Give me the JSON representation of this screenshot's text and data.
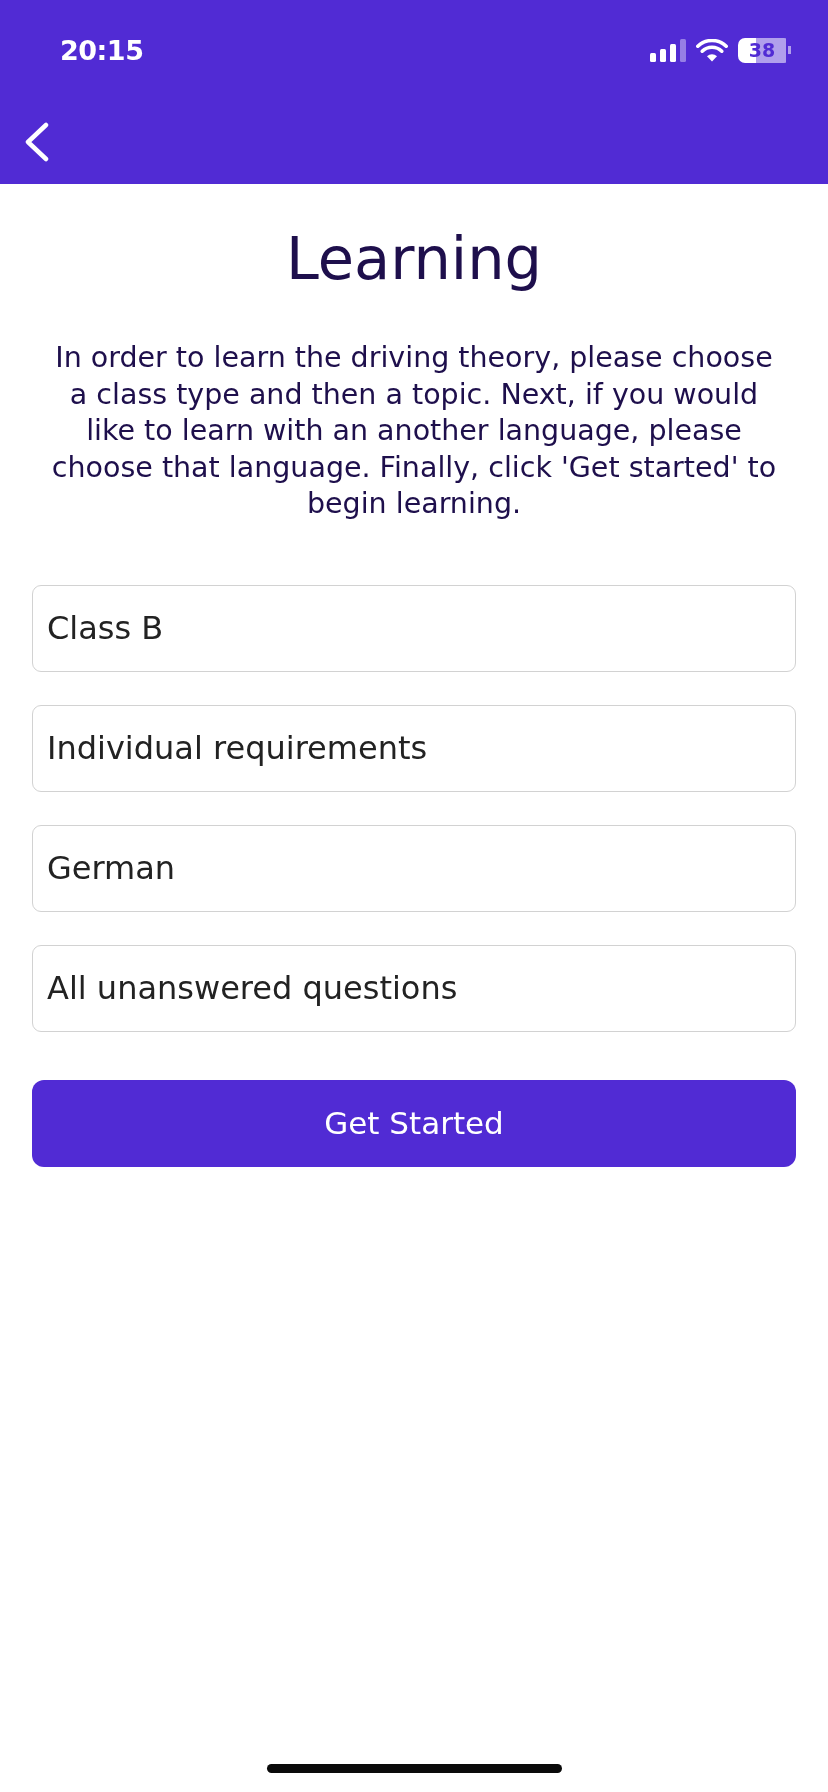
{
  "status_bar": {
    "time": "20:15",
    "battery": "38"
  },
  "title": "Learning",
  "intro": "In order to learn the driving theory, please choose a class type and then a topic. Next, if you would like to learn with an another language, please choose that language. Finally, click 'Get started' to begin learning.",
  "pickers": [
    "Class B",
    "Individual requirements",
    "German",
    "All unanswered questions"
  ],
  "button": "Get Started"
}
